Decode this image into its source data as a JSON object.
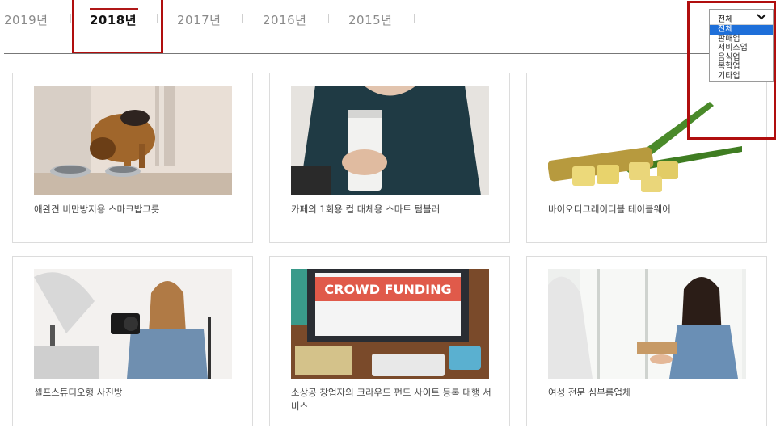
{
  "year_tabs": [
    {
      "label": "2019년",
      "active": false
    },
    {
      "label": "2018년",
      "active": true
    },
    {
      "label": "2017년",
      "active": false
    },
    {
      "label": "2016년",
      "active": false
    },
    {
      "label": "2015년",
      "active": false
    }
  ],
  "category_select": {
    "selected": "전체",
    "options": [
      "전체",
      "판매업",
      "서비스업",
      "음식업",
      "복합업",
      "기타업"
    ]
  },
  "cards": [
    {
      "title": "애완견 비만방지용 스마크밥그릇",
      "image": "dog-eating-photo"
    },
    {
      "title": "카페의 1회용 컵 대체용 스마트 텀블러",
      "image": "tumbler-photo"
    },
    {
      "title": "바이오디그레이더블 테이블웨어",
      "image": "sugarcane-photo"
    },
    {
      "title": "셀프스튜디오형 사진방",
      "image": "photographer-photo"
    },
    {
      "title": "소상공 창업자의 크라우드 펀드 사이트 등록 대행 서비스",
      "image": "crowd-funding-photo",
      "image_text": "CROWD FUNDING"
    },
    {
      "title": "여성 전문 심부름업체",
      "image": "delivery-woman-photo"
    }
  ],
  "colors": {
    "highlight": "#b00e0e",
    "active_underline": "#b01818",
    "selected_option": "#1e6fd9"
  }
}
